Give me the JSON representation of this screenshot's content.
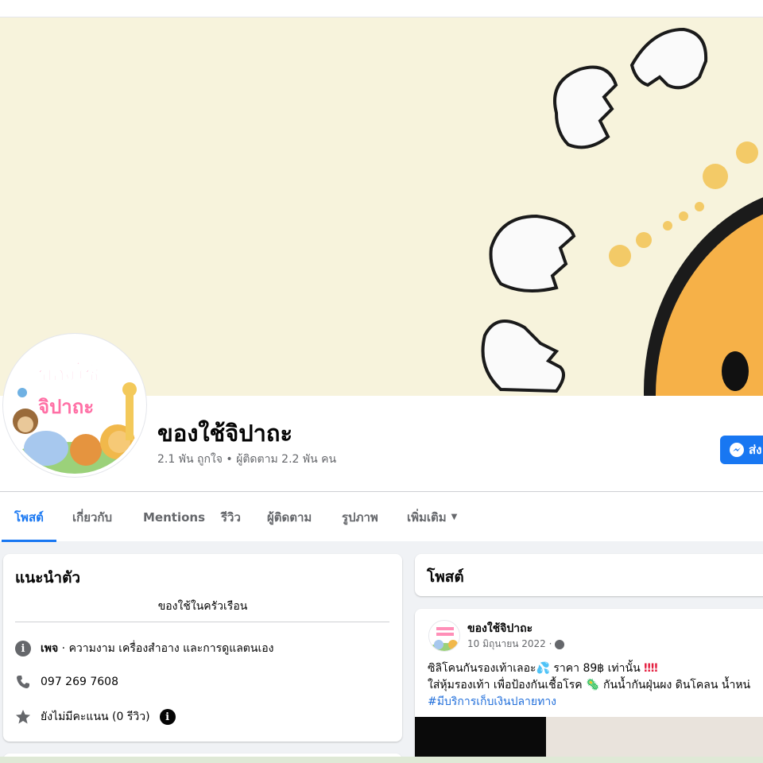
{
  "page": {
    "name": "ของใช้จิปาถะ",
    "likes": "2.1 พัน ถูกใจ",
    "separator": "•",
    "followers": "ผู้ติดตาม 2.2 พัน คน",
    "avatar_text_line1": "ของใช้",
    "avatar_text_line2": "จิปาถะ"
  },
  "actions": {
    "message_label": "ส่ง"
  },
  "tabs": [
    {
      "label": "โพสต์",
      "active": true
    },
    {
      "label": "เกี่ยวกับ",
      "active": false
    },
    {
      "label": "Mentions",
      "active": false
    },
    {
      "label": "รีวิว",
      "active": false
    },
    {
      "label": "ผู้ติดตาม",
      "active": false
    },
    {
      "label": "รูปภาพ",
      "active": false
    },
    {
      "label": "เพิ่มเติม",
      "active": false
    }
  ],
  "intro": {
    "title": "แนะนำตัว",
    "bio": "ของใช้ในครัวเรือน",
    "page_type_bold": "เพจ",
    "page_type_rest": " · ความงาม เครื่องสำอาง และการดูแลตนเอง",
    "phone": "097 269 7608",
    "rating": "ยังไม่มีคะแนน (0 รีวิว)"
  },
  "posts": {
    "header": "โพสต์",
    "items": [
      {
        "author": "ของใช้จิปาถะ",
        "date": "10 มิถุนายน 2022 ·",
        "line1_a": "ซิลิโคนกันรองเท้าเลอะ",
        "line1_emoji": "💦",
        "line1_b": " ราคา 89฿ เท่านั้น",
        "line1_marks": "‼‼",
        "line2_a": "ใส่หุ้มรองเท้า เพื่อป้องกันเชื้อโรค ",
        "line2_emoji": "🦠",
        "line2_b": " กันน้ำกันฝุ่นผง ดินโคลน  น้ำหน่",
        "hashtag": "#มีบริการเก็บเงินปลายทาง"
      }
    ]
  },
  "colors": {
    "accent": "#1877f2",
    "cover_bg": "#f7f3dc",
    "page_bg": "#f0f2f5",
    "hashtag": "#216fdb"
  }
}
